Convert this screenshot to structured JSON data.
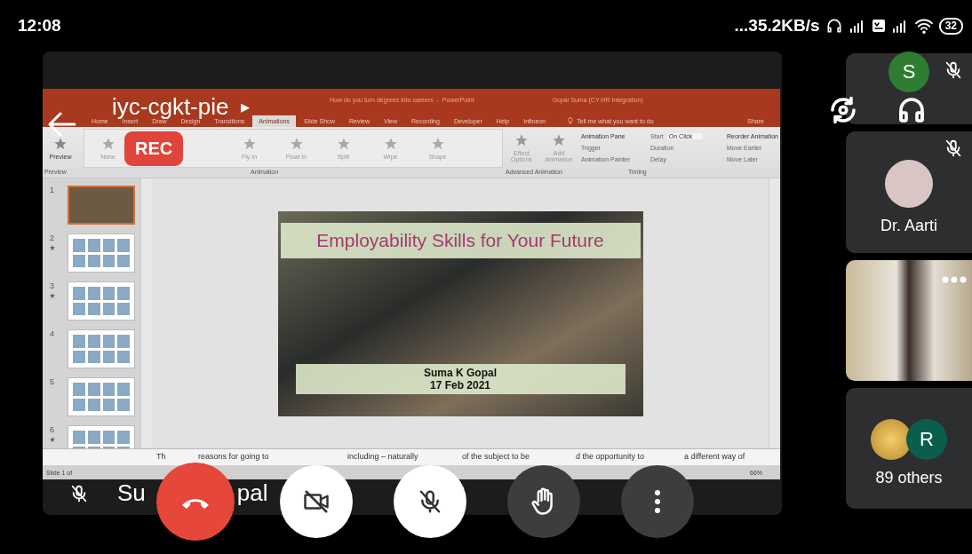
{
  "status_bar": {
    "time": "12:08",
    "network_speed": "...35.2KB/s",
    "battery": "32"
  },
  "meeting": {
    "code": "iyc-cgkt-pie",
    "caret": "▸",
    "recording": "REC",
    "presenter_name_parts": [
      "Su",
      "pal"
    ],
    "presenter_muted": true
  },
  "shared_screen": {
    "title_bar": {
      "document_title": "How do you turn degrees into careers  -  PowerPoint",
      "account": "Gopal Suma (CY HR Integration)"
    },
    "ribbon_tabs": [
      {
        "label": "Home",
        "selected": false
      },
      {
        "label": "Insert",
        "selected": false
      },
      {
        "label": "Draw",
        "selected": false
      },
      {
        "label": "Design",
        "selected": false
      },
      {
        "label": "Transitions",
        "selected": false
      },
      {
        "label": "Animations",
        "selected": true
      },
      {
        "label": "Slide Show",
        "selected": false
      },
      {
        "label": "Review",
        "selected": false
      },
      {
        "label": "View",
        "selected": false
      },
      {
        "label": "Recording",
        "selected": false
      },
      {
        "label": "Developer",
        "selected": false
      },
      {
        "label": "Help",
        "selected": false
      },
      {
        "label": "Infineon",
        "selected": false
      }
    ],
    "tell_me": "Tell me what you want to do",
    "share": "Share",
    "preview": "Preview",
    "animation_gallery": [
      "None",
      "Fly In",
      "Float In",
      "Split",
      "Wipe",
      "Shape"
    ],
    "effect_options": "Effect Options",
    "add_animation": "Add Animation",
    "advanced": [
      "Animation Pane",
      "Trigger",
      "Animation Painter"
    ],
    "timing": {
      "start_label": "Start",
      "start_value": "On Click",
      "duration_label": "Duration",
      "delay_label": "Delay"
    },
    "reorder": {
      "title": "Reorder Animation",
      "items": [
        "Move Earlier",
        "Move Later"
      ]
    },
    "group_labels": [
      "Preview",
      "Animation",
      "Advanced Animation",
      "Timing"
    ],
    "thumbnails": [
      {
        "number": "1",
        "selected": true,
        "animated": false
      },
      {
        "number": "2",
        "selected": false,
        "animated": true
      },
      {
        "number": "3",
        "selected": false,
        "animated": true
      },
      {
        "number": "4",
        "selected": false,
        "animated": false
      },
      {
        "number": "5",
        "selected": false,
        "animated": false
      },
      {
        "number": "6",
        "selected": false,
        "animated": true
      }
    ],
    "slide": {
      "title": "Employability Skills for Your Future",
      "presenter": "Suma K Gopal",
      "date": "17 Feb 2021"
    },
    "notes_fragments": [
      "Th",
      "reasons for going to",
      "including – naturally",
      "of the subject to be",
      "d the opportunity to",
      "a different way of"
    ],
    "slide_counter": "Slide 1 of",
    "zoom": "66%"
  },
  "participants": [
    {
      "kind": "letter",
      "initial": "S",
      "color": "#2e7d32",
      "muted": true
    },
    {
      "kind": "photo",
      "name": "Dr. Aarti",
      "muted": true
    },
    {
      "kind": "video",
      "muted": false
    },
    {
      "kind": "group",
      "avatars": [
        {
          "kind": "image"
        },
        {
          "kind": "letter",
          "initial": "R",
          "color": "#0b5e4d"
        }
      ],
      "label": "89 others",
      "muted": false
    }
  ],
  "controls": {
    "camera_on": false,
    "mic_on": false
  }
}
